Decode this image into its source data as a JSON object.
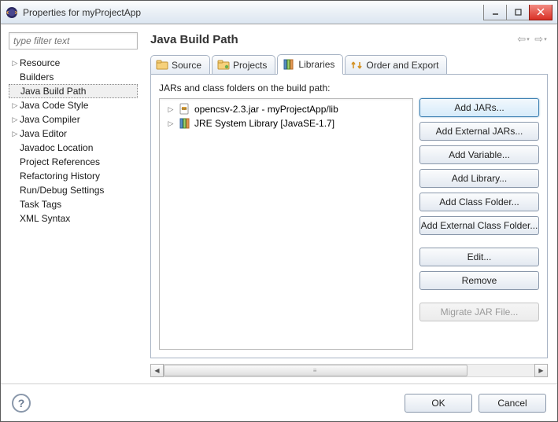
{
  "window": {
    "title": "Properties for myProjectApp"
  },
  "sidebar": {
    "filter_placeholder": "type filter text",
    "items": [
      {
        "label": "Resource",
        "expandable": true
      },
      {
        "label": "Builders",
        "expandable": false
      },
      {
        "label": "Java Build Path",
        "expandable": false,
        "selected": true
      },
      {
        "label": "Java Code Style",
        "expandable": true
      },
      {
        "label": "Java Compiler",
        "expandable": true
      },
      {
        "label": "Java Editor",
        "expandable": true
      },
      {
        "label": "Javadoc Location",
        "expandable": false
      },
      {
        "label": "Project References",
        "expandable": false
      },
      {
        "label": "Refactoring History",
        "expandable": false
      },
      {
        "label": "Run/Debug Settings",
        "expandable": false
      },
      {
        "label": "Task Tags",
        "expandable": false
      },
      {
        "label": "XML Syntax",
        "expandable": false
      }
    ]
  },
  "content": {
    "title": "Java Build Path",
    "tabs": [
      {
        "label": "Source",
        "icon": "source-folder-icon"
      },
      {
        "label": "Projects",
        "icon": "projects-icon"
      },
      {
        "label": "Libraries",
        "icon": "library-icon",
        "active": true
      },
      {
        "label": "Order and Export",
        "icon": "order-export-icon"
      }
    ],
    "jars_label": "JARs and class folders on the build path:",
    "jar_entries": [
      {
        "label": "opencsv-2.3.jar - myProjectApp/lib",
        "icon": "jar-file-icon"
      },
      {
        "label": "JRE System Library [JavaSE-1.7]",
        "icon": "library-books-icon"
      }
    ],
    "buttons": {
      "add_jars": "Add JARs...",
      "add_external_jars": "Add External JARs...",
      "add_variable": "Add Variable...",
      "add_library": "Add Library...",
      "add_class_folder": "Add Class Folder...",
      "add_external_class_folder": "Add External Class Folder...",
      "edit": "Edit...",
      "remove": "Remove",
      "migrate": "Migrate JAR File..."
    }
  },
  "footer": {
    "ok": "OK",
    "cancel": "Cancel"
  }
}
